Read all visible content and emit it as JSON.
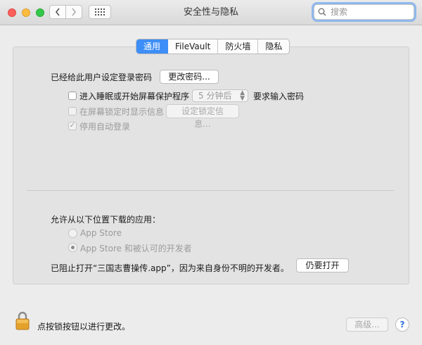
{
  "window": {
    "title": "安全性与隐私"
  },
  "search": {
    "placeholder": "搜索"
  },
  "tabs": [
    {
      "label": "通用",
      "active": true
    },
    {
      "label": "FileVault",
      "active": false
    },
    {
      "label": "防火墙",
      "active": false
    },
    {
      "label": "隐私",
      "active": false
    }
  ],
  "general": {
    "password_label": "已经给此用户设定登录密码",
    "change_password_button": "更改密码...",
    "sleep_checkbox_label": "进入睡眠或开始屏幕保护程序",
    "sleep_delay_value": "5 分钟后",
    "require_password_label": "要求输入密码",
    "lock_message_label": "在屏幕锁定时显示信息",
    "set_lock_message_button": "设定锁定信息...",
    "auto_login_label": "停用自动登录",
    "auto_login_check": "✓"
  },
  "downloads": {
    "heading": "允许从以下位置下载的应用：",
    "option_app_store": "App Store",
    "option_identified": "App Store 和被认可的开发者",
    "blocked_message": "已阻止打开“三国志曹操传.app”，因为来自身份不明的开发者。",
    "open_anyway_button": "仍要打开"
  },
  "footer": {
    "lock_text": "点按锁按钮以进行更改。",
    "advanced_button": "高级...",
    "help_label": "?"
  },
  "colors": {
    "accent": "#3d8ef7",
    "close": "#fc605c",
    "minimize": "#fdbc40",
    "maximize": "#34c84a",
    "lock": "#e4a12b"
  }
}
